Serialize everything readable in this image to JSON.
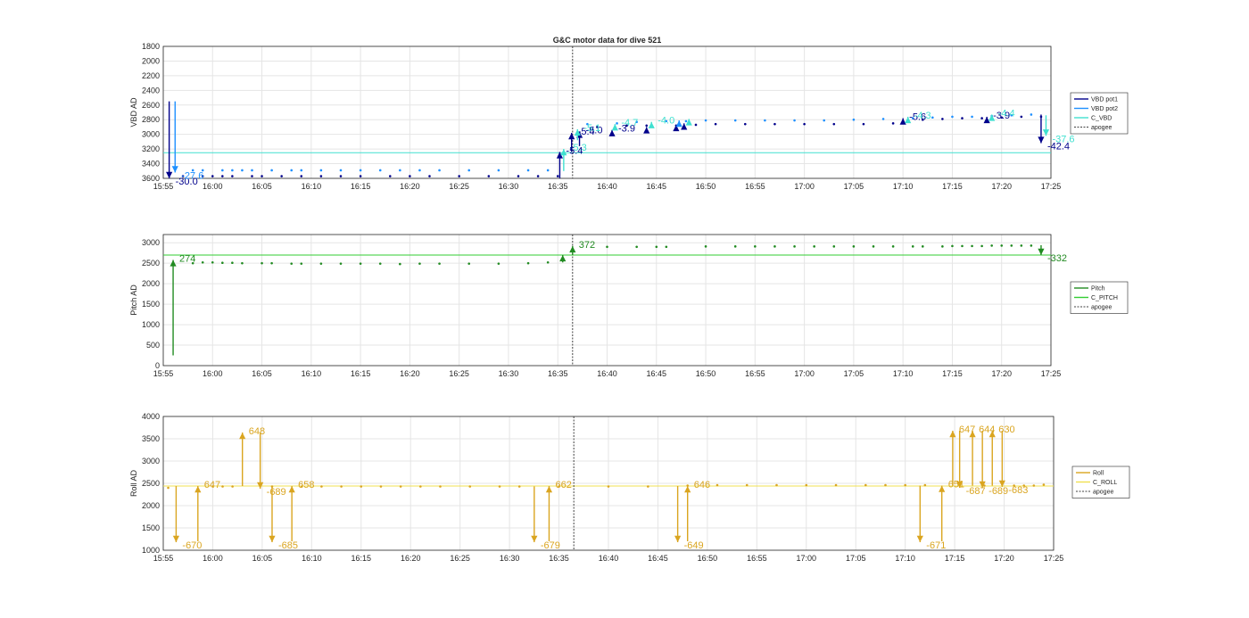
{
  "colors": {
    "vbd_pot1": "#00008b",
    "vbd_pot2": "#1e90ff",
    "c_vbd": "#40e0d0",
    "pitch": "#228b22",
    "c_pitch": "#32cd32",
    "roll": "#daa520",
    "c_roll": "#f0e050",
    "apogee": "#404040",
    "grid": "#e5e5e5",
    "axis": "#262626"
  },
  "chart_data": [
    {
      "type": "line",
      "title": "G&C motor data for dive 521",
      "ylabel": "VBD AD",
      "ylim": [
        1800,
        3600
      ],
      "y_reversed": true,
      "yticks": [
        "1800",
        "2000",
        "2200",
        "2400",
        "2600",
        "2800",
        "3000",
        "3200",
        "3400",
        "3600"
      ],
      "xlim": [
        "15:55",
        "17:25"
      ],
      "xticks": [
        "15:55",
        "16:00",
        "16:05",
        "16:10",
        "16:15",
        "16:20",
        "16:25",
        "16:30",
        "16:35",
        "16:40",
        "16:45",
        "16:50",
        "16:55",
        "17:00",
        "17:05",
        "17:10",
        "17:15",
        "17:20",
        "17:25"
      ],
      "grid": true,
      "apogee_x": "16:36.5",
      "legend": {
        "placement": "outside-right",
        "entries": [
          "VBD pot1",
          "VBD pot2",
          "C_VBD",
          "apogee"
        ]
      },
      "constant_lines": [
        {
          "name": "C_VBD",
          "value": 3250
        }
      ],
      "series": [
        {
          "name": "VBD pot1",
          "x": [
            "15:57",
            "15:59",
            "16:00",
            "16:01",
            "16:02",
            "16:04",
            "16:05",
            "16:07",
            "16:09",
            "16:11",
            "16:13",
            "16:15",
            "16:18",
            "16:20",
            "16:22",
            "16:25",
            "16:28",
            "16:31",
            "16:33",
            "16:35",
            "16:39",
            "16:42",
            "16:44",
            "16:47",
            "16:49",
            "16:51",
            "16:54",
            "16:57",
            "17:00",
            "17:03",
            "17:06",
            "17:09",
            "17:12",
            "17:14",
            "17:16",
            "17:18",
            "17:20",
            "17:22",
            "17:24"
          ],
          "y": [
            3570,
            3570,
            3570,
            3570,
            3570,
            3570,
            3570,
            3570,
            3570,
            3570,
            3570,
            3570,
            3570,
            3570,
            3570,
            3570,
            3570,
            3570,
            3570,
            3570,
            2900,
            2880,
            2880,
            2880,
            2870,
            2860,
            2860,
            2860,
            2860,
            2860,
            2860,
            2850,
            2800,
            2790,
            2780,
            2780,
            2770,
            2760,
            2760
          ]
        },
        {
          "name": "VBD pot2",
          "x": [
            "15:58",
            "15:59",
            "16:01",
            "16:02",
            "16:03",
            "16:04",
            "16:06",
            "16:08",
            "16:09",
            "16:11",
            "16:13",
            "16:15",
            "16:17",
            "16:19",
            "16:21",
            "16:23",
            "16:26",
            "16:29",
            "16:32",
            "16:34",
            "16:38",
            "16:41",
            "16:43",
            "16:46",
            "16:48",
            "16:50",
            "16:53",
            "16:56",
            "16:59",
            "17:02",
            "17:05",
            "17:08",
            "17:11",
            "17:13",
            "17:15",
            "17:17",
            "17:19",
            "17:21",
            "17:23"
          ],
          "y": [
            3490,
            3490,
            3490,
            3490,
            3490,
            3490,
            3490,
            3490,
            3490,
            3490,
            3490,
            3490,
            3490,
            3490,
            3490,
            3490,
            3490,
            3490,
            3490,
            3490,
            2860,
            2850,
            2830,
            2820,
            2820,
            2810,
            2810,
            2810,
            2810,
            2810,
            2800,
            2790,
            2780,
            2770,
            2760,
            2760,
            2750,
            2740,
            2730
          ]
        }
      ],
      "annotations": [
        {
          "x": "15:55.6",
          "y0": 2550,
          "y1": 3600,
          "label": "-30.0",
          "series": "VBD pot1"
        },
        {
          "x": "15:56.2",
          "y0": 2550,
          "y1": 3520,
          "label": "-27.6",
          "series": "VBD pot2"
        },
        {
          "x": "16:35.2",
          "y0": 3600,
          "y1": 3240,
          "label": "-5.4",
          "series": "VBD pot1"
        },
        {
          "x": "16:35.6",
          "y0": 3500,
          "y1": 3200,
          "label": "-5.3",
          "series": "C_VBD"
        },
        {
          "x": "16:36.4",
          "y0": 3240,
          "y1": 2980,
          "label": "-5.4",
          "series": "VBD pot1"
        },
        {
          "x": "16:37.2",
          "y0": 3160,
          "y1": 2960,
          "label": "-5.0",
          "series": "VBD pot1"
        },
        {
          "x": "16:37.0",
          "y0": 3080,
          "y1": 2930,
          "label": "-5.1",
          "series": "C_VBD"
        },
        {
          "x": "16:40.5",
          "y0": 3020,
          "y1": 2940,
          "label": "-3.9",
          "series": "VBD pot1"
        },
        {
          "x": "16:40.8",
          "y0": 2900,
          "y1": 2860,
          "label": "-4.7",
          "series": "C_VBD"
        },
        {
          "x": "16:44.5",
          "y0": 2870,
          "y1": 2830,
          "label": "-4.0",
          "series": "C_VBD"
        },
        {
          "x": "16:44.0",
          "y0": 2940,
          "y1": 2900,
          "label": "",
          "series": "VBD pot1"
        },
        {
          "x": "16:47.0",
          "y0": 2910,
          "y1": 2870,
          "label": "",
          "series": "VBD pot1"
        },
        {
          "x": "16:47.3",
          "y0": 2850,
          "y1": 2810,
          "label": "",
          "series": "VBD pot2"
        },
        {
          "x": "16:47.8",
          "y0": 2890,
          "y1": 2850,
          "label": "",
          "series": "VBD pot1"
        },
        {
          "x": "16:48.3",
          "y0": 2830,
          "y1": 2790,
          "label": "",
          "series": "C_VBD"
        },
        {
          "x": "17:10.0",
          "y0": 2850,
          "y1": 2780,
          "label": "-5.6",
          "series": "VBD pot1"
        },
        {
          "x": "17:10.5",
          "y0": 2810,
          "y1": 2760,
          "label": "-4.3",
          "series": "C_VBD"
        },
        {
          "x": "17:18.5",
          "y0": 2800,
          "y1": 2760,
          "label": "-3.9",
          "series": "VBD pot1"
        },
        {
          "x": "17:19.0",
          "y0": 2770,
          "y1": 2730,
          "label": "-4.4",
          "series": "C_VBD"
        },
        {
          "x": "17:24.0",
          "y0": 2730,
          "y1": 3120,
          "label": "-42.4",
          "series": "VBD pot1"
        },
        {
          "x": "17:24.5",
          "y0": 2740,
          "y1": 3020,
          "label": "-37.6",
          "series": "C_VBD"
        }
      ]
    },
    {
      "type": "line",
      "title": "",
      "ylabel": "Pitch AD",
      "ylim": [
        0,
        3200
      ],
      "yticks": [
        "0",
        "500",
        "1000",
        "1500",
        "2000",
        "2500",
        "3000"
      ],
      "xlim": [
        "15:55",
        "17:25"
      ],
      "xticks": [
        "15:55",
        "16:00",
        "16:05",
        "16:10",
        "16:15",
        "16:20",
        "16:25",
        "16:30",
        "16:35",
        "16:40",
        "16:45",
        "16:50",
        "16:55",
        "17:00",
        "17:05",
        "17:10",
        "17:15",
        "17:20",
        "17:25"
      ],
      "grid": true,
      "apogee_x": "16:36.5",
      "legend": {
        "placement": "outside-right",
        "entries": [
          "Pitch",
          "C_PITCH",
          "apogee"
        ]
      },
      "constant_lines": [
        {
          "name": "C_PITCH",
          "value": 2700
        }
      ],
      "series": [
        {
          "name": "Pitch",
          "x": [
            "15:58",
            "15:59",
            "16:00",
            "16:01",
            "16:02",
            "16:03",
            "16:05",
            "16:06",
            "16:08",
            "16:09",
            "16:11",
            "16:13",
            "16:15",
            "16:17",
            "16:19",
            "16:21",
            "16:23",
            "16:26",
            "16:29",
            "16:32",
            "16:34",
            "16:40",
            "16:43",
            "16:45",
            "16:46",
            "16:50",
            "16:53",
            "16:55",
            "16:57",
            "16:59",
            "17:01",
            "17:03",
            "17:05",
            "17:07",
            "17:09",
            "17:11",
            "17:12",
            "17:14",
            "17:15",
            "17:16",
            "17:17",
            "17:18",
            "17:19",
            "17:20",
            "17:21",
            "17:22",
            "17:23"
          ],
          "y": [
            2500,
            2520,
            2520,
            2510,
            2510,
            2500,
            2500,
            2500,
            2490,
            2490,
            2490,
            2490,
            2490,
            2490,
            2480,
            2490,
            2490,
            2490,
            2490,
            2500,
            2520,
            2900,
            2900,
            2900,
            2900,
            2910,
            2910,
            2910,
            2910,
            2910,
            2910,
            2910,
            2910,
            2910,
            2910,
            2910,
            2910,
            2910,
            2920,
            2920,
            2920,
            2920,
            2930,
            2930,
            2930,
            2930,
            2930
          ]
        }
      ],
      "annotations": [
        {
          "x": "15:56.0",
          "y0": 250,
          "y1": 2580,
          "label": "274",
          "series": "Pitch"
        },
        {
          "x": "16:35.5",
          "y0": 2520,
          "y1": 2700,
          "label": "",
          "series": "Pitch"
        },
        {
          "x": "16:36.5",
          "y0": 2700,
          "y1": 2920,
          "label": "372",
          "series": "Pitch"
        },
        {
          "x": "17:24.0",
          "y0": 2940,
          "y1": 2700,
          "label": "-332",
          "series": "Pitch"
        }
      ]
    },
    {
      "type": "line",
      "title": "",
      "ylabel": "Roll AD",
      "ylim": [
        1000,
        4000
      ],
      "yticks": [
        "1000",
        "1500",
        "2000",
        "2500",
        "3000",
        "3500",
        "4000"
      ],
      "xlim": [
        "15:55",
        "17:25"
      ],
      "xticks": [
        "15:55",
        "16:00",
        "16:05",
        "16:10",
        "16:15",
        "16:20",
        "16:25",
        "16:30",
        "16:35",
        "16:40",
        "16:45",
        "16:50",
        "16:55",
        "17:00",
        "17:05",
        "17:10",
        "17:15",
        "17:20",
        "17:25"
      ],
      "grid": true,
      "apogee_x": "16:36.5",
      "legend": {
        "placement": "outside-right",
        "entries": [
          "Roll",
          "C_ROLL",
          "apogee"
        ]
      },
      "constant_lines": [
        {
          "name": "C_ROLL",
          "value": 2440
        }
      ],
      "series": [
        {
          "name": "Roll",
          "x": [
            "15:55.5",
            "16:00",
            "16:01",
            "16:02",
            "16:06",
            "16:09",
            "16:11",
            "16:13",
            "16:15",
            "16:17",
            "16:19",
            "16:21",
            "16:23",
            "16:26",
            "16:29",
            "16:31",
            "16:35",
            "16:40",
            "16:44",
            "16:48",
            "16:51",
            "16:54",
            "16:57",
            "17:00",
            "17:03",
            "17:06",
            "17:08",
            "17:10",
            "17:12",
            "17:18",
            "17:21",
            "17:22",
            "17:23",
            "17:24"
          ],
          "y": [
            2400,
            2430,
            2430,
            2430,
            2430,
            2430,
            2430,
            2430,
            2430,
            2430,
            2430,
            2430,
            2430,
            2430,
            2430,
            2430,
            2430,
            2430,
            2430,
            2450,
            2460,
            2460,
            2460,
            2460,
            2460,
            2460,
            2460,
            2460,
            2460,
            2450,
            2450,
            2450,
            2450,
            2470
          ]
        }
      ],
      "annotations": [
        {
          "x": "15:56.3",
          "y0": 2440,
          "y1": 1180,
          "label": "-670",
          "series": "Roll"
        },
        {
          "x": "15:58.5",
          "y0": 1200,
          "y1": 2440,
          "label": "647",
          "series": "Roll"
        },
        {
          "x": "16:03.0",
          "y0": 2440,
          "y1": 3640,
          "label": "648",
          "series": "Roll"
        },
        {
          "x": "16:04.8",
          "y0": 3640,
          "y1": 2380,
          "label": "-689",
          "series": "Roll"
        },
        {
          "x": "16:06.0",
          "y0": 2440,
          "y1": 1180,
          "label": "-685",
          "series": "Roll"
        },
        {
          "x": "16:08.0",
          "y0": 1200,
          "y1": 2440,
          "label": "658",
          "series": "Roll"
        },
        {
          "x": "16:32.5",
          "y0": 2430,
          "y1": 1180,
          "label": "-679",
          "series": "Roll"
        },
        {
          "x": "16:34.0",
          "y0": 1200,
          "y1": 2440,
          "label": "662",
          "series": "Roll"
        },
        {
          "x": "16:47.0",
          "y0": 2440,
          "y1": 1180,
          "label": "-649",
          "series": "Roll"
        },
        {
          "x": "16:48.0",
          "y0": 1200,
          "y1": 2440,
          "label": "646",
          "series": "Roll"
        },
        {
          "x": "17:11.5",
          "y0": 2450,
          "y1": 1180,
          "label": "-671",
          "series": "Roll"
        },
        {
          "x": "17:13.7",
          "y0": 1200,
          "y1": 2450,
          "label": "651",
          "series": "Roll"
        },
        {
          "x": "17:14.8",
          "y0": 2450,
          "y1": 3680,
          "label": "647",
          "series": "Roll"
        },
        {
          "x": "17:15.5",
          "y0": 3680,
          "y1": 2400,
          "label": "-687",
          "series": "Roll"
        },
        {
          "x": "17:16.8",
          "y0": 2450,
          "y1": 3680,
          "label": "644",
          "series": "Roll"
        },
        {
          "x": "17:17.8",
          "y0": 3680,
          "y1": 2400,
          "label": "-689",
          "series": "Roll"
        },
        {
          "x": "17:18.8",
          "y0": 2450,
          "y1": 3680,
          "label": "630",
          "series": "Roll"
        },
        {
          "x": "17:19.8",
          "y0": 3680,
          "y1": 2420,
          "label": "-683",
          "series": "Roll"
        }
      ]
    }
  ]
}
